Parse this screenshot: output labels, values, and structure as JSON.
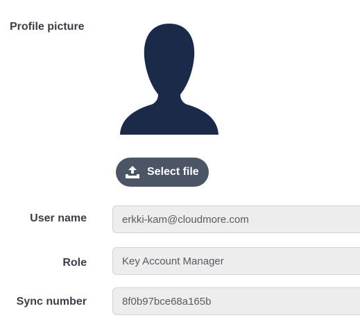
{
  "profile": {
    "label": "Profile picture",
    "select_file_label": "Select file",
    "avatar_color": "#1b2a48",
    "button_color": "#4b5565"
  },
  "fields": {
    "user_name": {
      "label": "User name",
      "value": "erkki-kam@cloudmore.com"
    },
    "role": {
      "label": "Role",
      "value": "Key Account Manager"
    },
    "sync_number": {
      "label": "Sync number",
      "value": "8f0b97bce68a165b"
    }
  },
  "icons": {
    "avatar": "user-silhouette-icon",
    "upload": "upload-icon"
  }
}
